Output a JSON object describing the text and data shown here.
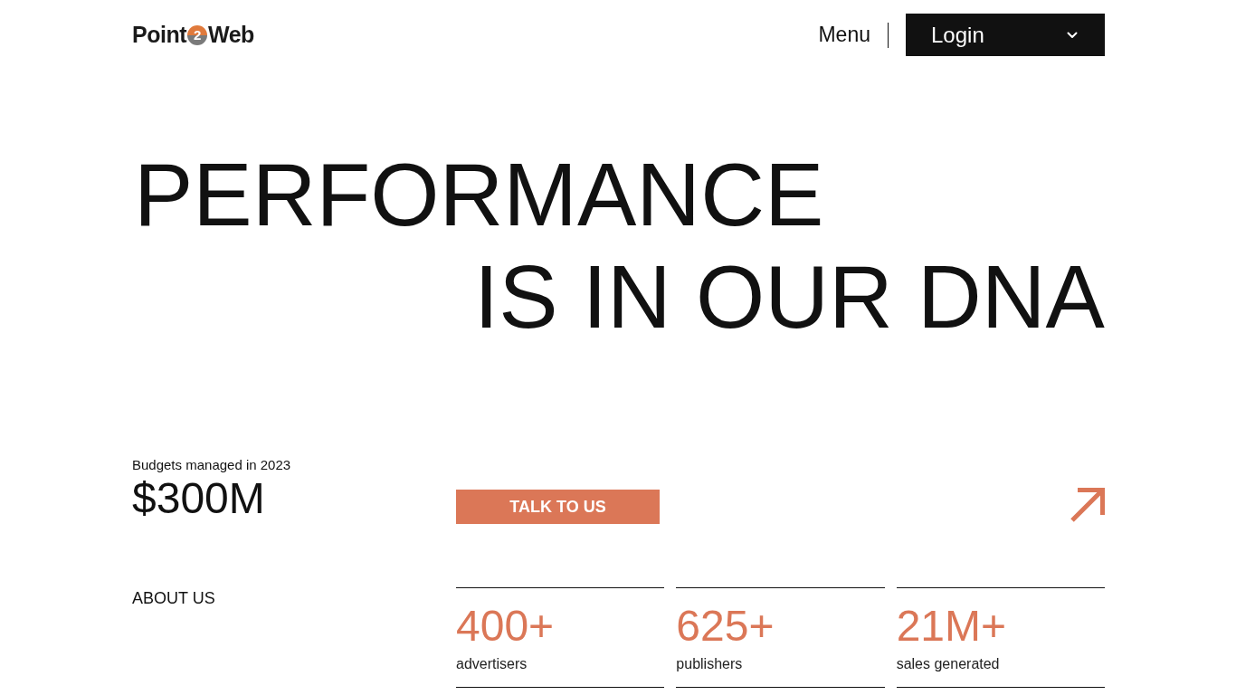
{
  "header": {
    "logo": {
      "text_before": "Point",
      "mark": "2",
      "text_after": "Web"
    },
    "menu": {
      "label": "Menu"
    },
    "login": {
      "label": "Login"
    }
  },
  "hero": {
    "lines": [
      "PERFORMANCE",
      "IS IN OUR DNA"
    ]
  },
  "budget": {
    "caption": "Budgets managed in 2023",
    "value": "$300M"
  },
  "cta": {
    "label": "TALK TO US"
  },
  "about": {
    "heading": "ABOUT US"
  },
  "stats": [
    {
      "value": "400+",
      "label": "advertisers"
    },
    {
      "value": "625+",
      "label": "publishers"
    },
    {
      "value": "21M+",
      "label": "sales generated"
    }
  ]
}
